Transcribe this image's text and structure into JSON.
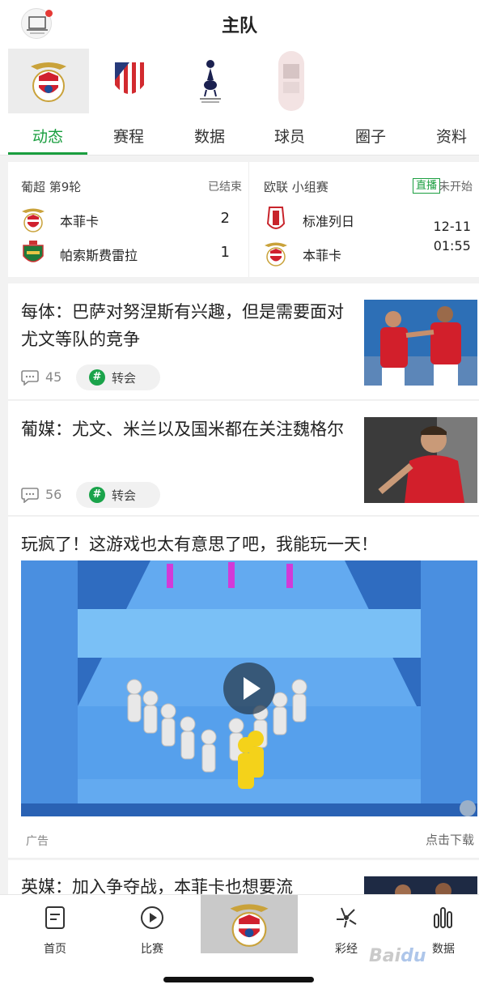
{
  "header": {
    "title": "主队"
  },
  "teams": [
    {
      "name": "Benfica",
      "icon": "benfica-crest-icon",
      "active": true
    },
    {
      "name": "Atletico Madrid",
      "icon": "atletico-crest-icon"
    },
    {
      "name": "Tottenham",
      "icon": "tottenham-crest-icon"
    },
    {
      "name": "blurred",
      "icon": "blurred-crest-icon"
    }
  ],
  "tabs": [
    "动态",
    "赛程",
    "数据",
    "球员",
    "圈子",
    "资料"
  ],
  "matches": [
    {
      "league": "葡超 第9轮",
      "status": "已结束",
      "home": {
        "name": "本菲卡",
        "score": "2"
      },
      "away": {
        "name": "帕索斯费雷拉",
        "score": "1"
      }
    },
    {
      "league": "欧联 小组赛",
      "live_label": "直播",
      "status": "未开始",
      "home": {
        "name": "标准列日"
      },
      "away": {
        "name": "本菲卡"
      },
      "date": "12-11",
      "time": "01:55"
    }
  ],
  "news": [
    {
      "title": "每体：巴萨对努涅斯有兴趣，但是需要面对尤文等队的竞争",
      "comments": "45",
      "tag": "转会"
    },
    {
      "title": "葡媒：尤文、米兰以及国米都在关注魏格尔",
      "comments": "56",
      "tag": "转会"
    }
  ],
  "ad": {
    "title": "玩疯了！这游戏也太有意思了吧，我能玩一天！",
    "label": "广告",
    "download": "点击下载"
  },
  "news_partial": {
    "title": "英媒：加入争夺战，本菲卡也想要流"
  },
  "bottom_nav": [
    {
      "label": "首页",
      "icon": "home-doc-icon"
    },
    {
      "label": "比赛",
      "icon": "play-circle-icon"
    },
    {
      "label": "",
      "icon": "benfica-crest-icon"
    },
    {
      "label": "彩经",
      "icon": "star-burst-icon"
    },
    {
      "label": "数据",
      "icon": "bar-chart-icon"
    }
  ],
  "colors": {
    "accent": "#1a9e3f",
    "benfica_red": "#d0202e"
  }
}
